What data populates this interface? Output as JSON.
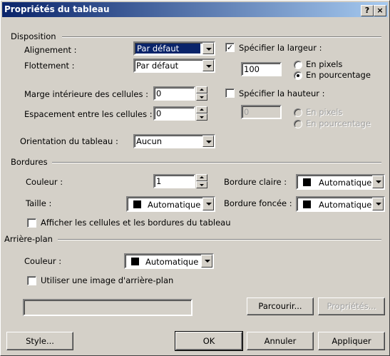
{
  "window": {
    "title": "Propriétés du tableau",
    "help_btn": "?",
    "close_btn": "×"
  },
  "layout_section": {
    "title": "Disposition",
    "alignment_label": "Alignement :",
    "alignment_value": "Par défaut",
    "float_label": "Flottement :",
    "float_value": "Par défaut",
    "specify_width_label": "Spécifier la largeur :",
    "specify_width_checked": true,
    "width_value": "100",
    "in_pixels_label": "En pixels",
    "in_percent_label": "En pourcentage",
    "cell_padding_label": "Marge intérieure des cellules :",
    "cell_padding_value": "0",
    "specify_height_label": "Spécifier la hauteur :",
    "specify_height_checked": false,
    "cell_spacing_label": "Espacement entre les cellules :",
    "cell_spacing_value": "0",
    "height_value": "0",
    "height_pixels_label": "En pixels",
    "height_percent_label": "En pourcentage",
    "orientation_label": "Orientation du tableau :",
    "orientation_value": "Aucun"
  },
  "borders_section": {
    "title": "Bordures",
    "color_label": "Couleur :",
    "color_value": "1",
    "light_border_label": "Bordure claire :",
    "light_border_value": "Automatique",
    "size_label": "Taille :",
    "size_value": "Automatique",
    "dark_border_label": "Bordure foncée :",
    "dark_border_value": "Automatique",
    "show_cells_label": "Afficher les cellules et les bordures du tableau",
    "show_cells_checked": false
  },
  "background_section": {
    "title": "Arrière-plan",
    "color_label": "Couleur :",
    "color_value": "Automatique",
    "use_image_label": "Utiliser une image d'arrière-plan",
    "use_image_checked": false,
    "image_path": "",
    "browse_label": "Parcourir...",
    "properties_label": "Propriétés..."
  },
  "footer": {
    "style_label": "Style...",
    "ok_label": "OK",
    "cancel_label": "Annuler",
    "apply_label": "Appliquer"
  },
  "colors": {
    "title_gradient_start": "#0a246a",
    "title_gradient_end": "#a6caf0",
    "face": "#d4d0c8",
    "selection": "#0a246a"
  }
}
